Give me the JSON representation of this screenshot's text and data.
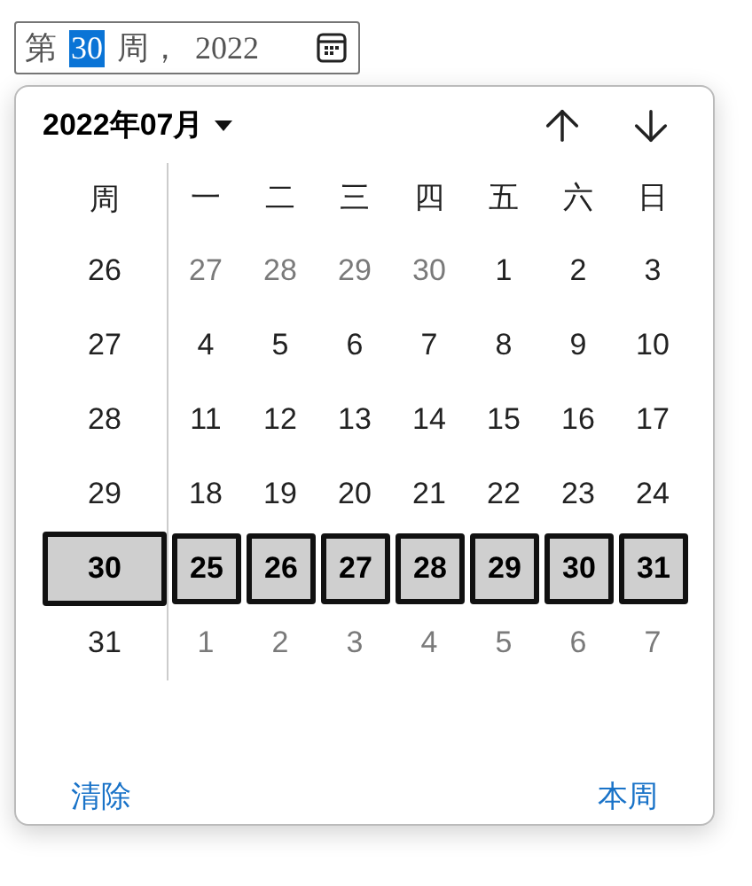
{
  "input": {
    "prefix": "第",
    "week": "30",
    "week_selected": true,
    "suffix": "周，",
    "year": "2022"
  },
  "popup": {
    "month_label": "2022年07月",
    "week_header": "周",
    "weekdays": [
      "一",
      "二",
      "三",
      "四",
      "五",
      "六",
      "日"
    ],
    "weeks": [
      {
        "week": "26",
        "selected": false,
        "days": [
          {
            "day": "27",
            "outside": true
          },
          {
            "day": "28",
            "outside": true
          },
          {
            "day": "29",
            "outside": true
          },
          {
            "day": "30",
            "outside": true
          },
          {
            "day": "1",
            "outside": false
          },
          {
            "day": "2",
            "outside": false
          },
          {
            "day": "3",
            "outside": false
          }
        ]
      },
      {
        "week": "27",
        "selected": false,
        "days": [
          {
            "day": "4",
            "outside": false
          },
          {
            "day": "5",
            "outside": false
          },
          {
            "day": "6",
            "outside": false
          },
          {
            "day": "7",
            "outside": false
          },
          {
            "day": "8",
            "outside": false
          },
          {
            "day": "9",
            "outside": false
          },
          {
            "day": "10",
            "outside": false
          }
        ]
      },
      {
        "week": "28",
        "selected": false,
        "days": [
          {
            "day": "11",
            "outside": false
          },
          {
            "day": "12",
            "outside": false
          },
          {
            "day": "13",
            "outside": false
          },
          {
            "day": "14",
            "outside": false
          },
          {
            "day": "15",
            "outside": false
          },
          {
            "day": "16",
            "outside": false
          },
          {
            "day": "17",
            "outside": false
          }
        ]
      },
      {
        "week": "29",
        "selected": false,
        "days": [
          {
            "day": "18",
            "outside": false
          },
          {
            "day": "19",
            "outside": false
          },
          {
            "day": "20",
            "outside": false
          },
          {
            "day": "21",
            "outside": false
          },
          {
            "day": "22",
            "outside": false
          },
          {
            "day": "23",
            "outside": false
          },
          {
            "day": "24",
            "outside": false
          }
        ]
      },
      {
        "week": "30",
        "selected": true,
        "days": [
          {
            "day": "25",
            "outside": false
          },
          {
            "day": "26",
            "outside": false
          },
          {
            "day": "27",
            "outside": false
          },
          {
            "day": "28",
            "outside": false
          },
          {
            "day": "29",
            "outside": false
          },
          {
            "day": "30",
            "outside": false
          },
          {
            "day": "31",
            "outside": false
          }
        ]
      },
      {
        "week": "31",
        "selected": false,
        "days": [
          {
            "day": "1",
            "outside": true
          },
          {
            "day": "2",
            "outside": true
          },
          {
            "day": "3",
            "outside": true
          },
          {
            "day": "4",
            "outside": true
          },
          {
            "day": "5",
            "outside": true
          },
          {
            "day": "6",
            "outside": true
          },
          {
            "day": "7",
            "outside": true
          }
        ]
      }
    ],
    "clear_button": "清除",
    "this_week_button": "本周"
  }
}
